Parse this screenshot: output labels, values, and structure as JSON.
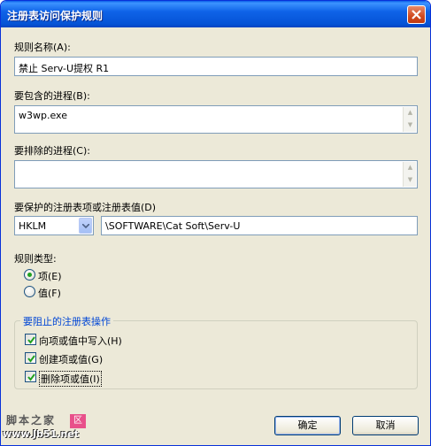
{
  "window": {
    "title": "注册表访问保护规则"
  },
  "rule_name": {
    "label": "规则名称(A):",
    "value": "禁止 Serv-U提权 R1"
  },
  "include_process": {
    "label": "要包含的进程(B):",
    "value": "w3wp.exe"
  },
  "exclude_process": {
    "label": "要排除的进程(C):",
    "value": ""
  },
  "registry": {
    "label": "要保护的注册表项或注册表值(D)",
    "hive": "HKLM",
    "path": "\\SOFTWARE\\Cat Soft\\Serv-U"
  },
  "rule_type": {
    "label": "规则类型:",
    "options": [
      {
        "label": "项(E)",
        "selected": true
      },
      {
        "label": "值(F)",
        "selected": false
      }
    ]
  },
  "operations": {
    "title": "要阻止的注册表操作",
    "items": [
      {
        "label": "向项或值中写入(H)",
        "checked": true
      },
      {
        "label": "创建项或值(G)",
        "checked": true
      },
      {
        "label": "删除项或值(I)",
        "checked": true
      }
    ]
  },
  "buttons": {
    "ok": "确定",
    "cancel": "取消"
  },
  "watermark": {
    "line1": "脚本之家",
    "badge": "区",
    "line2": "www.Jb51.net"
  },
  "colors": {
    "titlebar": "#0553d5",
    "dialog_bg": "#ece9d8",
    "group_title": "#0046d5",
    "field_border": "#7f9db9"
  }
}
